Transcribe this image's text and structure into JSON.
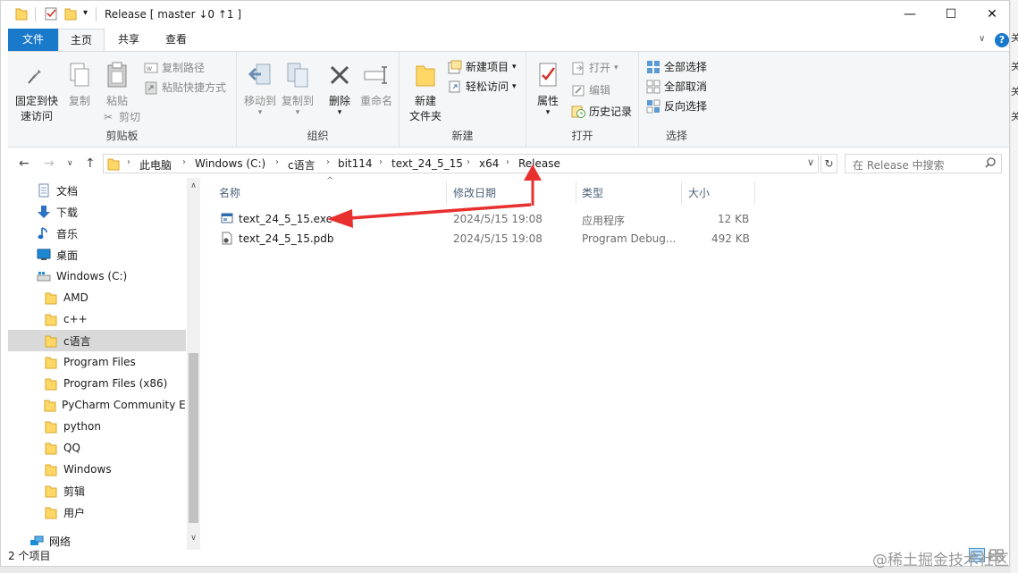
{
  "window": {
    "title": "Release [ master ↓0 ↑1 ]",
    "controls": {
      "minimize": "—",
      "maximize": "☐",
      "close": "✕"
    }
  },
  "ribbon_tabs": [
    "文件",
    "主页",
    "共享",
    "查看"
  ],
  "ribbon": {
    "clipboard": {
      "label": "剪贴板",
      "pin_label": "固定到快速访问",
      "pin_line1": "固定到快",
      "pin_line2": "速访问",
      "copy": "复制",
      "paste": "粘贴",
      "copy_path": "复制路径",
      "paste_shortcut": "粘贴快捷方式",
      "cut": "剪切"
    },
    "organize": {
      "label": "组织",
      "move_to": "移动到",
      "copy_to": "复制到",
      "delete": "删除",
      "rename": "重命名"
    },
    "new": {
      "label": "新建",
      "new_folder_line1": "新建",
      "new_folder_line2": "文件夹",
      "new_item": "新建项目",
      "easy_access": "轻松访问"
    },
    "open": {
      "label": "打开",
      "properties": "属性",
      "open": "打开",
      "edit": "编辑",
      "history": "历史记录"
    },
    "select": {
      "label": "选择",
      "select_all": "全部选择",
      "select_none": "全部取消",
      "invert": "反向选择"
    }
  },
  "address": {
    "breadcrumbs": [
      "此电脑",
      "Windows (C:)",
      "c语言",
      "bit114",
      "text_24_5_15",
      "x64",
      "Release"
    ],
    "search_placeholder": "在 Release 中搜索"
  },
  "navpane": {
    "quick": [
      {
        "label": "文档",
        "icon": "document-icon"
      },
      {
        "label": "下载",
        "icon": "download-icon"
      },
      {
        "label": "音乐",
        "icon": "music-icon"
      },
      {
        "label": "桌面",
        "icon": "desktop-icon"
      }
    ],
    "drive": "Windows  (C:)",
    "folders": [
      "AMD",
      "c++",
      "c语言",
      "Program Files",
      "Program Files (x86)",
      "PyCharm Community Ed",
      "python",
      "QQ",
      "Windows",
      "剪辑",
      "用户"
    ],
    "selected": "c语言",
    "network": "网络"
  },
  "columns": [
    "名称",
    "修改日期",
    "类型",
    "大小"
  ],
  "files": [
    {
      "name": "text_24_5_15.exe",
      "date": "2024/5/15 19:08",
      "type": "应用程序",
      "size": "12 KB",
      "icon": "exe-icon"
    },
    {
      "name": "text_24_5_15.pdb",
      "date": "2024/5/15 19:08",
      "type": "Program Debug...",
      "size": "492 KB",
      "icon": "pdb-file-icon"
    }
  ],
  "status": {
    "item_count": "2 个项目"
  },
  "watermark": "@稀土掘金技术社区",
  "colors": {
    "accent": "#1979ca",
    "annotation_arrow": "#e8302f",
    "selection": "#d9d9d9",
    "folder": "#ffd766"
  }
}
